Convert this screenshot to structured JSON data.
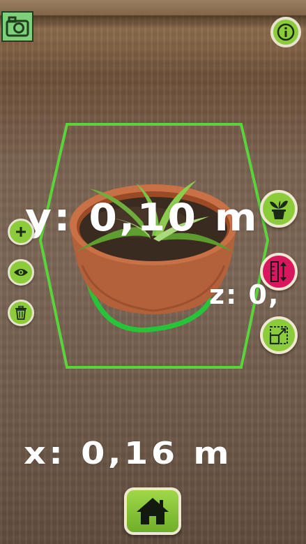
{
  "screen": {
    "type": "AR plant placement view"
  },
  "measurements": {
    "y_label": "y: 0,10 m",
    "z_label": "z: 0,",
    "x_label": "x: 0,16 m"
  },
  "buttons": {
    "camera": {
      "icon": "camera-icon"
    },
    "info": {
      "icon": "info-icon"
    },
    "add": {
      "icon": "plus-icon"
    },
    "visibility": {
      "icon": "eye-icon"
    },
    "delete": {
      "icon": "trash-icon"
    },
    "plant_catalog": {
      "icon": "potted-plant-icon"
    },
    "height_measure": {
      "icon": "vertical-measure-icon"
    },
    "scale": {
      "icon": "resize-icon"
    },
    "home": {
      "icon": "home-icon"
    }
  },
  "colors": {
    "button_green": "#8ccc3b",
    "button_pink": "#d8175e",
    "bounding_box": "#59d43a",
    "button_border": "#e8e3cf",
    "camera_green": "#7fd07a"
  }
}
